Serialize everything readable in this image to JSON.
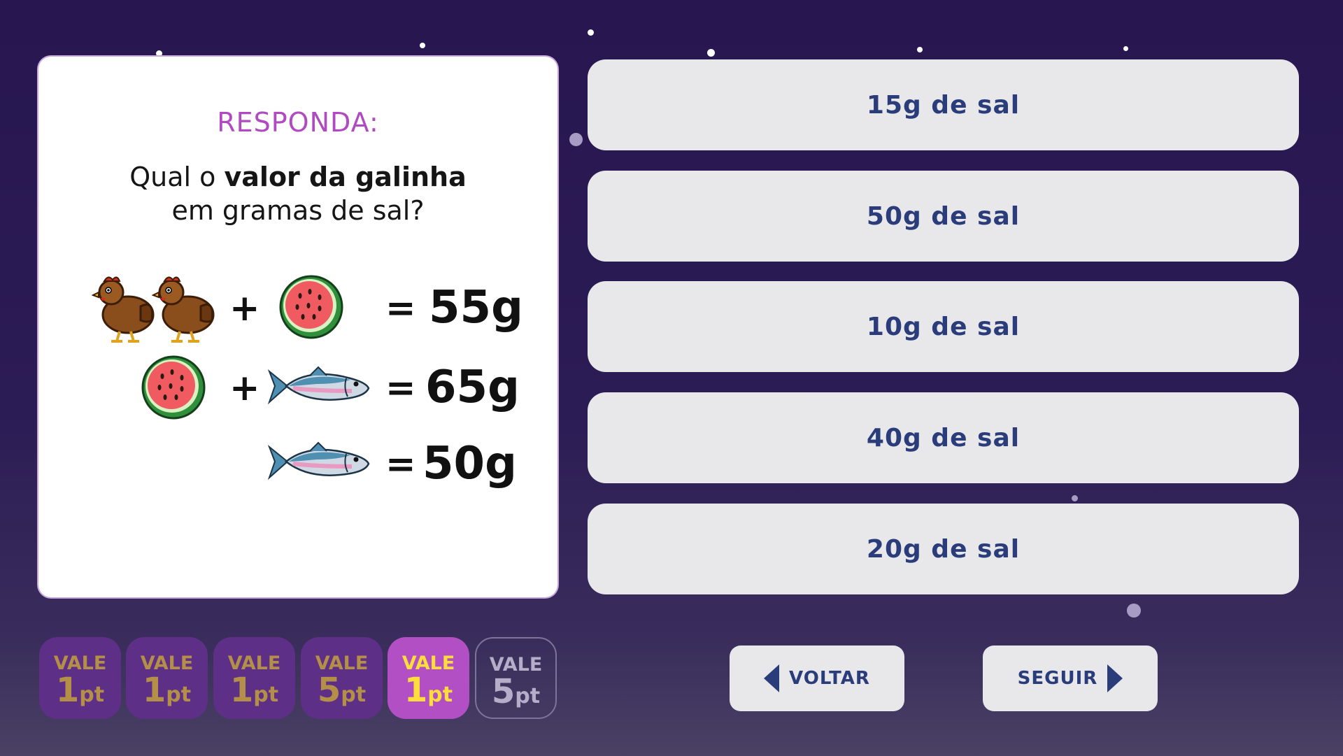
{
  "question": {
    "heading": "RESPONDA:",
    "line1_prefix": "Qual o ",
    "line1_bold": "valor da galinha",
    "line2": "em gramas de sal?"
  },
  "equations": [
    {
      "lhs": [
        "chicken-icon",
        "chicken-icon",
        "+",
        "watermelon-icon"
      ],
      "equals": "=",
      "value": "55g"
    },
    {
      "lhs": [
        "watermelon-icon",
        "+",
        "fish-icon"
      ],
      "equals": "=",
      "value": "65g"
    },
    {
      "lhs": [
        "fish-icon"
      ],
      "equals": "=",
      "value": "50g"
    }
  ],
  "symbols": {
    "plus": "+",
    "equals": "="
  },
  "options": [
    {
      "label": "15g de sal"
    },
    {
      "label": "50g de sal"
    },
    {
      "label": "10g de sal"
    },
    {
      "label": "40g de sal"
    },
    {
      "label": "20g de sal"
    }
  ],
  "points": [
    {
      "vale": "VALE",
      "value": "1",
      "unit": "pt",
      "state": "used"
    },
    {
      "vale": "VALE",
      "value": "1",
      "unit": "pt",
      "state": "used"
    },
    {
      "vale": "VALE",
      "value": "1",
      "unit": "pt",
      "state": "used"
    },
    {
      "vale": "VALE",
      "value": "5",
      "unit": "pt",
      "state": "used"
    },
    {
      "vale": "VALE",
      "value": "1",
      "unit": "pt",
      "state": "active"
    },
    {
      "vale": "VALE",
      "value": "5",
      "unit": "pt",
      "state": "future"
    }
  ],
  "nav": {
    "back_label": "VOLTAR",
    "next_label": "SEGUIR"
  },
  "colors": {
    "background": "#271650",
    "heading": "#b04ac0",
    "option_bg": "#e8e8ea",
    "option_text": "#2a3d7a",
    "chip_used": "#5e2f86",
    "chip_active": "#b24fc4",
    "chip_active_text": "#ffdd3a"
  }
}
